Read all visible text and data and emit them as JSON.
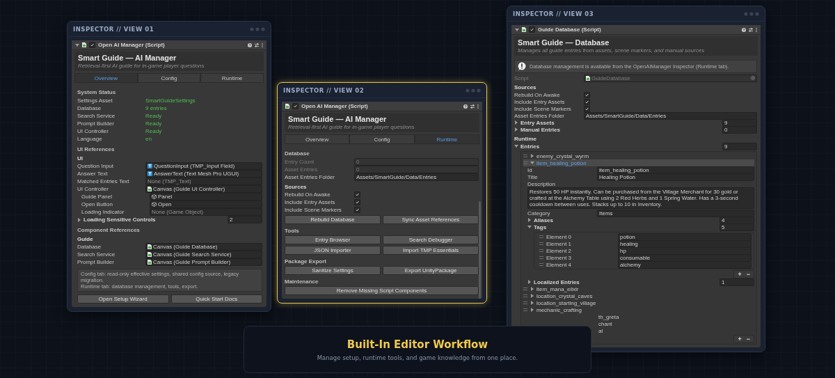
{
  "windows": [
    {
      "title": "INSPECTOR // VIEW 01",
      "highlighted": false,
      "component": {
        "name": "Open AI Manager (Script)",
        "enabled": true,
        "expanded": true,
        "heading": "Smart Guide — AI Manager",
        "subheading": "Retrieval-first AI guide for in-game player questions",
        "tabs": [
          {
            "label": "Overview",
            "selected": true
          },
          {
            "label": "Config",
            "selected": false
          },
          {
            "label": "Runtime",
            "selected": false
          }
        ],
        "rows": [
          {
            "kind": "header",
            "text": "System Status"
          },
          {
            "kind": "status",
            "label": "Settings Asset",
            "value": "SmartGuideSettings"
          },
          {
            "kind": "status",
            "label": "Database",
            "value": "9 entries"
          },
          {
            "kind": "status",
            "label": "Search Service",
            "value": "Ready"
          },
          {
            "kind": "status",
            "label": "Prompt Builder",
            "value": "Ready"
          },
          {
            "kind": "status",
            "label": "UI Controller",
            "value": "Ready"
          },
          {
            "kind": "status",
            "label": "Language",
            "value": "en"
          },
          {
            "kind": "header",
            "text": "UI References"
          },
          {
            "kind": "group",
            "text": "UI"
          },
          {
            "kind": "tmp_ref",
            "label": "Question Input",
            "value": "QuestionInput (TMP_Input Field)"
          },
          {
            "kind": "tmp_ref",
            "label": "Answer Text",
            "value": "AnswerText (Text Mesh Pro UGUI)"
          },
          {
            "kind": "empty_ref",
            "label": "Matched Entries Text",
            "value": "None (TMP_Text)"
          },
          {
            "kind": "script_ref",
            "label": "UI Controller",
            "value": "Canvas (Guide UI Controller)",
            "children": [
              {
                "kind": "object_ref",
                "label": "Guide Panel",
                "value": "Panel"
              },
              {
                "kind": "object_ref",
                "label": "Open Button",
                "value": "Open"
              },
              {
                "kind": "empty_ref",
                "label": "Loading Indicator",
                "value": "None (Game Object)"
              }
            ]
          },
          {
            "kind": "foldout",
            "label": "Loading Sensitive Controls",
            "count": "2",
            "expanded": false
          },
          {
            "kind": "header",
            "text": "Component References"
          },
          {
            "kind": "group",
            "text": "Guide"
          },
          {
            "kind": "script_ref",
            "label": "Database",
            "value": "Canvas (Guide Database)"
          },
          {
            "kind": "script_ref",
            "label": "Search Service",
            "value": "Canvas (Guide Search Service)"
          },
          {
            "kind": "script_ref",
            "label": "Prompt Builder",
            "value": "Canvas (Guide Prompt Builder)"
          },
          {
            "kind": "info",
            "lines": [
              "Config tab: read-only effective settings, shared config source, legacy migration.",
              "Runtime tab: database management, tools, export."
            ]
          },
          {
            "kind": "buttons",
            "labels": [
              "Open Setup Wizard",
              "Quick Start Docs"
            ]
          }
        ]
      }
    },
    {
      "title": "INSPECTOR // VIEW 02",
      "highlighted": true,
      "component": {
        "name": "Open AI Manager (Script)",
        "enabled": true,
        "heading": "Smart Guide — AI Manager",
        "subheading": "Retrieval-first AI guide for in-game player questions",
        "tabs": [
          {
            "label": "Overview",
            "selected": false
          },
          {
            "label": "Config",
            "selected": false
          },
          {
            "label": "Runtime",
            "selected": true
          }
        ],
        "rows": [
          {
            "kind": "header",
            "text": "Database"
          },
          {
            "kind": "text",
            "label": "Entry Count",
            "value": "0",
            "disabled": true
          },
          {
            "kind": "text",
            "label": "Asset Entries",
            "value": "0",
            "disabled": true
          },
          {
            "kind": "text",
            "label": "Asset Entries Folder",
            "value": "Assets/SmartGuide/Data/Entries",
            "disabled": false
          },
          {
            "kind": "group",
            "text": "Sources"
          },
          {
            "kind": "checkbox",
            "label": "Rebuild On Awake",
            "checked": true
          },
          {
            "kind": "checkbox",
            "label": "Include Entry Assets",
            "checked": true
          },
          {
            "kind": "checkbox",
            "label": "Include Scene Markers",
            "checked": true
          },
          {
            "kind": "buttons",
            "labels": [
              "Rebuild Database",
              "Sync Asset References"
            ]
          },
          {
            "kind": "header",
            "text": "Tools"
          },
          {
            "kind": "buttons",
            "labels": [
              "Entry Browser",
              "Search Debugger"
            ]
          },
          {
            "kind": "buttons",
            "labels": [
              "JSON Importer",
              "Import TMP Essentials"
            ]
          },
          {
            "kind": "header",
            "text": "Package Export"
          },
          {
            "kind": "buttons",
            "labels": [
              "Sanitize Settings",
              "Export UnityPackage"
            ]
          },
          {
            "kind": "header",
            "text": "Maintenance"
          },
          {
            "kind": "buttons",
            "labels": [
              "Remove Missing Script Components"
            ]
          }
        ]
      }
    },
    {
      "title": "INSPECTOR // VIEW 03",
      "highlighted": false,
      "component": {
        "name": "Guide Database (Script)",
        "enabled": true,
        "expanded": true,
        "heading": "Smart Guide — Database",
        "subheading": "Manages all guide entries from assets, scene markers, and manual sources",
        "rows": [
          {
            "kind": "notice",
            "text": "Database management is available from the OpenAIManager Inspector (Runtime tab)."
          },
          {
            "kind": "script_ref",
            "label": "Script",
            "value": "GuideDatabase",
            "disabled": true
          },
          {
            "kind": "group",
            "text": "Sources"
          },
          {
            "kind": "checkbox",
            "label": "Rebuild On Awake",
            "checked": true
          },
          {
            "kind": "checkbox",
            "label": "Include Entry Assets",
            "checked": true
          },
          {
            "kind": "checkbox",
            "label": "Include Scene Markers",
            "checked": true
          },
          {
            "kind": "text",
            "label": "Asset Entries Folder",
            "value": "Assets/SmartGuide/Data/Entries",
            "disabled": false
          },
          {
            "kind": "foldout",
            "label": "Entry Assets",
            "count": "9",
            "expanded": false
          },
          {
            "kind": "foldout",
            "label": "Manual Entries",
            "count": "0",
            "expanded": false
          },
          {
            "kind": "group",
            "text": "Runtime"
          },
          {
            "kind": "foldout",
            "label": "Entries",
            "count": "9",
            "expanded": true,
            "children": [
              {
                "kind": "list",
                "children": [
                  {
                    "kind": "entry",
                    "label": "enemy_crystal_wyrm",
                    "expanded": false,
                    "selected": false
                  },
                  {
                    "kind": "entry",
                    "label": "item_healing_potion",
                    "expanded": true,
                    "selected": true,
                    "children": [
                      {
                        "kind": "text",
                        "label": "Id",
                        "value": "item_healing_potion",
                        "disabled": false
                      },
                      {
                        "kind": "text",
                        "label": "Title",
                        "value": "Healing Potion",
                        "disabled": false
                      },
                      {
                        "kind": "textarea",
                        "label": "Description",
                        "value": "Restores 50 HP instantly. Can be purchased from the Village Merchant for 30 gold or crafted at the Alchemy Table using 2 Red Herbs and 1 Spring Water. Has a 3-second cooldown between uses. Stacks up to 10 in Inventory."
                      },
                      {
                        "kind": "text",
                        "label": "Category",
                        "value": "Items",
                        "disabled": false
                      },
                      {
                        "kind": "foldout",
                        "label": "Aliases",
                        "count": "4",
                        "expanded": false
                      },
                      {
                        "kind": "foldout",
                        "label": "Tags",
                        "count": "5",
                        "expanded": true,
                        "children": [
                          {
                            "kind": "list",
                            "children": [
                              {
                                "kind": "element",
                                "label": "Element 0",
                                "value": "potion"
                              },
                              {
                                "kind": "element",
                                "label": "Element 1",
                                "value": "healing"
                              },
                              {
                                "kind": "element",
                                "label": "Element 2",
                                "value": "hp"
                              },
                              {
                                "kind": "element",
                                "label": "Element 3",
                                "value": "consumable"
                              },
                              {
                                "kind": "element",
                                "label": "Element 4",
                                "value": "alchemy"
                              }
                            ]
                          },
                          {
                            "kind": "footer",
                            "labels": [
                              "+",
                              "−"
                            ]
                          }
                        ]
                      },
                      {
                        "kind": "foldout",
                        "label": "Localized Entries",
                        "count": "1",
                        "expanded": false
                      }
                    ]
                  },
                  {
                    "kind": "entry",
                    "label": "item_mana_elixir",
                    "expanded": false,
                    "selected": false
                  },
                  {
                    "kind": "entry",
                    "label": "location_crystal_caves",
                    "expanded": false,
                    "selected": false
                  },
                  {
                    "kind": "entry",
                    "label": "location_starting_village",
                    "expanded": false,
                    "selected": false
                  },
                  {
                    "kind": "entry",
                    "label": "mechanic_crafting",
                    "expanded": false,
                    "selected": false
                  },
                  {
                    "kind": "entry",
                    "label": "th_greta",
                    "expanded": false,
                    "selected": false,
                    "partial": true
                  },
                  {
                    "kind": "entry",
                    "label": "chant",
                    "expanded": false,
                    "selected": false,
                    "partial": true
                  },
                  {
                    "kind": "entry",
                    "label": "al",
                    "expanded": false,
                    "selected": false,
                    "partial": true
                  },
                  {
                    "kind": "footer",
                    "labels": [
                      "+",
                      "−"
                    ]
                  }
                ]
              }
            ]
          }
        ]
      }
    }
  ],
  "banner": {
    "title": "Built-In Editor Workflow",
    "subtitle": "Manage setup, runtime tools, and game knowledge from one place."
  }
}
